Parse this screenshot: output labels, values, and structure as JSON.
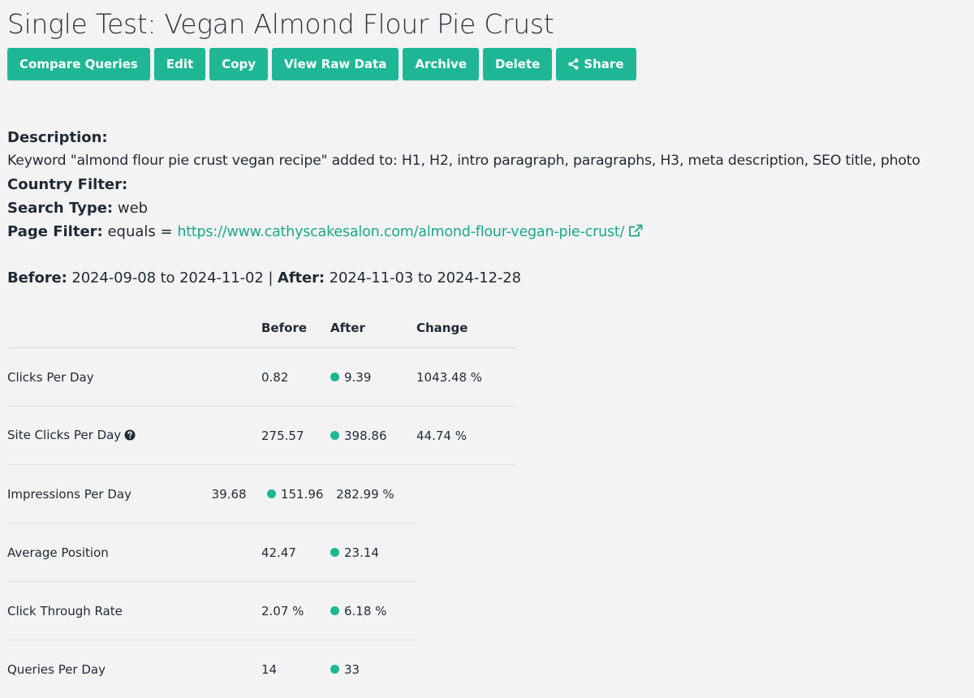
{
  "page": {
    "title": "Single Test: Vegan Almond Flour Pie Crust"
  },
  "toolbar": {
    "compare_label": "Compare Queries",
    "edit_label": "Edit",
    "copy_label": "Copy",
    "raw_label": "View Raw Data",
    "archive_label": "Archive",
    "delete_label": "Delete",
    "share_label": "Share",
    "share_icon": "share-icon"
  },
  "info": {
    "description_label": "Description:",
    "description_text": "Keyword \"almond flour pie crust vegan recipe\" added to: H1, H2, intro paragraph, paragraphs, H3, meta description, SEO title, photo",
    "country_label": "Country Filter:",
    "search_type_label": "Search Type:",
    "search_type_value": "web",
    "page_filter_label": "Page Filter:",
    "page_filter_op": "equals =",
    "page_filter_url": "https://www.cathyscakesalon.com/almond-flour-vegan-pie-crust/",
    "external_icon": "external-link-icon"
  },
  "period": {
    "before_label": "Before:",
    "before_range": "2024-09-08 to 2024-11-02",
    "separator": "|",
    "after_label": "After:",
    "after_range": "2024-11-03 to 2024-12-28"
  },
  "metrics": {
    "headers": [
      "",
      "Before",
      "After",
      "Change"
    ],
    "rows": [
      {
        "name": "Clicks Per Day",
        "before": "0.82",
        "after": "9.39",
        "change": "1043.48 %"
      },
      {
        "name": "Site Clicks Per Day",
        "before": "275.57",
        "after": "398.86",
        "change": "44.74 %",
        "help_icon": "question-circle-icon"
      },
      {
        "name": "Impressions Per Day",
        "before": "39.68",
        "after": "151.96",
        "change": "282.99 %"
      },
      {
        "name": "Average Position",
        "before": "42.47",
        "after": "23.14",
        "change": ""
      },
      {
        "name": "Click Through Rate",
        "before": "2.07 %",
        "after": "6.18 %",
        "change": ""
      },
      {
        "name": "Queries Per Day",
        "before": "14",
        "after": "33",
        "change": ""
      }
    ]
  },
  "colors": {
    "accent": "#1fb696",
    "link": "#1aa88a",
    "text": "#1f2a37",
    "background": "#f3f3f3"
  }
}
